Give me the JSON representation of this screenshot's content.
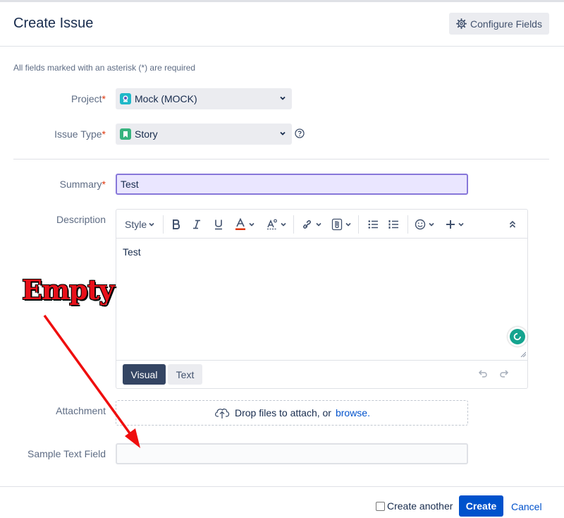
{
  "header": {
    "title": "Create Issue",
    "configure_label": "Configure Fields"
  },
  "required_note": "All fields marked with an asterisk (*) are required",
  "fields": {
    "project": {
      "label": "Project",
      "value": "Mock (MOCK)"
    },
    "issue_type": {
      "label": "Issue Type",
      "value": "Story"
    },
    "summary": {
      "label": "Summary",
      "value": "Test"
    },
    "description": {
      "label": "Description",
      "style_label": "Style",
      "body": "Test",
      "mode_visual": "Visual",
      "mode_text": "Text"
    },
    "attachment": {
      "label": "Attachment",
      "drop_text": "Drop files to attach, or",
      "browse_link": "browse."
    },
    "sample_text": {
      "label": "Sample Text Field",
      "value": ""
    }
  },
  "footer": {
    "create_another_label": "Create another",
    "create_label": "Create",
    "cancel_label": "Cancel"
  },
  "annotation": {
    "text": "Empty",
    "color": "#e8101a"
  },
  "colors": {
    "primary": "#0052cc",
    "summary_bg": "#eae6ff",
    "summary_border": "#8777d9",
    "project_icon": "#1fb8c8",
    "story_icon": "#36b37e",
    "required": "#de350b"
  },
  "icons": [
    "gear-icon",
    "chevron-down-icon",
    "help-icon",
    "bold-icon",
    "italic-icon",
    "underline-icon",
    "text-color-icon",
    "text-effects-icon",
    "link-icon",
    "attachment-icon",
    "bullet-list-icon",
    "numbered-list-icon",
    "emoji-icon",
    "plus-icon",
    "collapse-icon",
    "undo-icon",
    "redo-icon",
    "upload-cloud-icon"
  ]
}
